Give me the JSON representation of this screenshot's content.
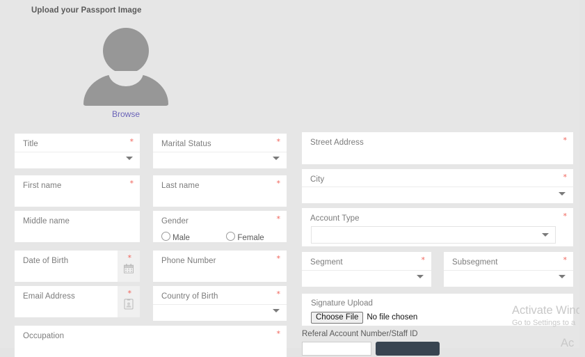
{
  "upload": {
    "title": "Upload your Passport Image",
    "browse_label": "Browse",
    "avatar_icon": "person-placeholder-icon"
  },
  "required_mark": "*",
  "colors": {
    "page_background": "#e6e6e6",
    "field_background": "#ffffff",
    "required_asterisk": "#f0635a",
    "link": "#6a63b8",
    "label_text": "#7b7b7b",
    "avatar_gray": "#979797",
    "referral_button": "#384451"
  },
  "left_column": {
    "fields": [
      {
        "label": "Title",
        "required": true,
        "type": "select"
      },
      {
        "label": "First name",
        "required": true,
        "type": "text"
      },
      {
        "label": "Middle name",
        "required": false,
        "type": "text"
      },
      {
        "label": "Date of Birth",
        "required": true,
        "type": "date",
        "icon": "calendar-icon"
      },
      {
        "label": "Email Address",
        "required": true,
        "type": "text",
        "icon": "contact-card-icon"
      },
      {
        "label": "Occupation",
        "required": true,
        "type": "text"
      }
    ],
    "second_fields": [
      {
        "label": "Marital Status",
        "required": true,
        "type": "select"
      },
      {
        "label": "Last name",
        "required": true,
        "type": "text"
      },
      {
        "label": "Gender",
        "required": true,
        "type": "radio",
        "options": [
          "Male",
          "Female"
        ],
        "selected": ""
      },
      {
        "label": "Phone Number",
        "required": true,
        "type": "text"
      },
      {
        "label": "Country of Birth",
        "required": true,
        "type": "select"
      }
    ]
  },
  "right_column": {
    "fields": [
      {
        "label": "Street Address",
        "required": true,
        "type": "text"
      },
      {
        "label": "City",
        "required": true,
        "type": "select"
      },
      {
        "label": "Account Type",
        "required": true,
        "type": "select-boxed"
      },
      {
        "label": "Segment",
        "required": true,
        "type": "select"
      },
      {
        "label": "Subsegment",
        "required": true,
        "type": "select"
      }
    ],
    "signature": {
      "label": "Signature Upload",
      "choose_file_label": "Choose File",
      "file_status": "No file chosen"
    },
    "referral": {
      "label": "Referal Account Number/Staff ID",
      "input_value": "",
      "button_label": ""
    }
  },
  "watermark": {
    "line1": "Activate Wind",
    "line2": "Go to Settings to a",
    "line3": "Ac"
  }
}
